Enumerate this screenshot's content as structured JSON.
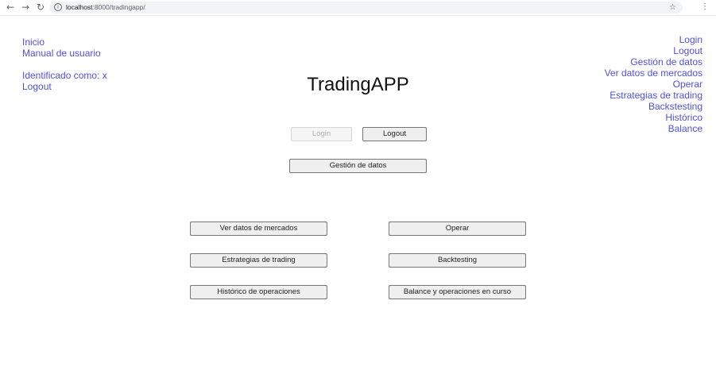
{
  "browser": {
    "url_host": "localhost",
    "url_rest": ":8000/tradingapp/",
    "icons": {
      "back": "arrow-left-icon",
      "forward": "arrow-right-icon",
      "reload": "reload-icon",
      "info": "info-icon",
      "star": "star-icon",
      "menu": "kebab-menu-icon"
    }
  },
  "left_nav": {
    "inicio": "Inicio",
    "manual": "Manual de usuario",
    "identified_prefix": "Identificado como: ",
    "username": "x",
    "logout": "Logout"
  },
  "right_nav": {
    "items": [
      "Login",
      "Logout",
      "Gestión de datos",
      "Ver datos de mercados",
      "Operar",
      "Estrategias de trading",
      "Backstesting",
      "Histórico",
      "Balance"
    ]
  },
  "title": "TradingAPP",
  "buttons": {
    "login": "Login",
    "logout": "Logout",
    "gestion": "Gestión de datos",
    "ver_datos": "Ver datos de mercados",
    "operar": "Operar",
    "estrategias": "Estrategias de trading",
    "backtesting": "Backtesting",
    "historico": "Histórico de operaciones",
    "balance": "Balance y operaciones en curso"
  },
  "colors": {
    "link": "#5050e6",
    "button_bg": "#efefef",
    "disabled_text": "#b0b0b0"
  }
}
